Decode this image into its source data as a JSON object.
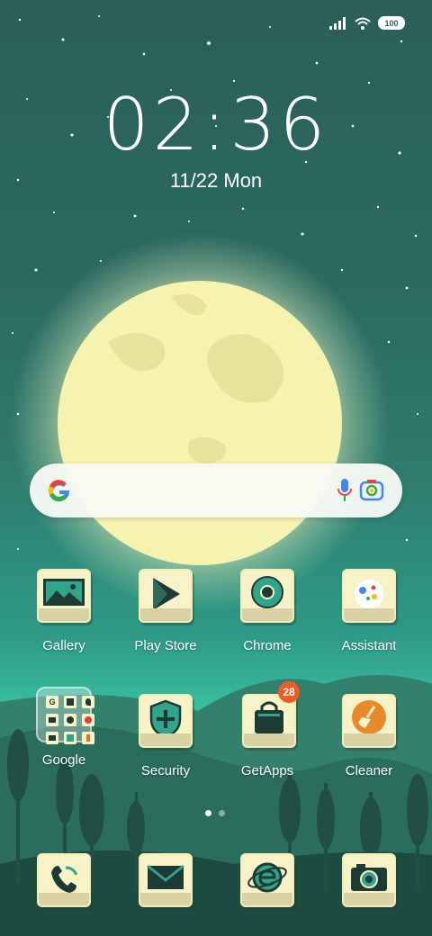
{
  "status": {
    "battery": "100",
    "signal_icon": "signal-icon",
    "wifi_icon": "wifi-icon"
  },
  "clock": {
    "time_h": "02",
    "separator": ":",
    "time_m": "36",
    "date": "11/22",
    "weekday": "Mon"
  },
  "search": {
    "placeholder": ""
  },
  "apps": {
    "gallery": "Gallery",
    "play_store": "Play Store",
    "chrome": "Chrome",
    "assistant": "Assistant",
    "google": "Google",
    "security": "Security",
    "getapps": "GetApps",
    "getapps_badge": "28",
    "cleaner": "Cleaner"
  },
  "folder_google": {
    "mini": [
      "G",
      "",
      "",
      "",
      "",
      "",
      "",
      "",
      ""
    ]
  },
  "pager": {
    "active_index": 0,
    "count": 2
  },
  "colors": {
    "tile": "#f7f2c8",
    "icon_dark": "#1e3a34",
    "badge": "#f05a24",
    "moon": "#f6f3b0"
  }
}
